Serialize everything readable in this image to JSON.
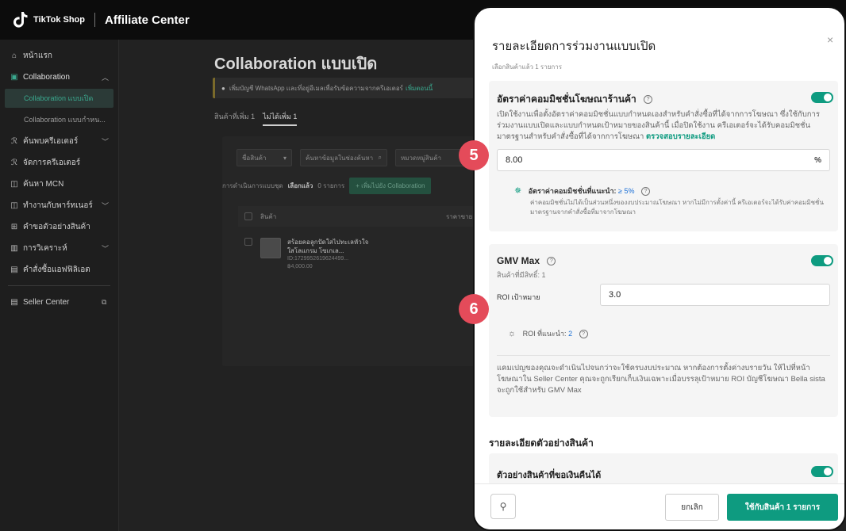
{
  "topbar": {
    "logo_text": "TikTok Shop",
    "title": "Affiliate Center"
  },
  "sidebar": {
    "items": [
      {
        "label": "หน้าแรก"
      },
      {
        "label": "Collaboration"
      },
      {
        "label": "Collaboration แบบเปิด"
      },
      {
        "label": "Collaboration แบบกำหน..."
      },
      {
        "label": "ค้นพบครีเอเตอร์"
      },
      {
        "label": "จัดการครีเอเตอร์"
      },
      {
        "label": "ค้นหา MCN"
      },
      {
        "label": "ทำงานกับพาร์ทเนอร์"
      },
      {
        "label": "คำขอตัวอย่างสินค้า"
      },
      {
        "label": "การวิเคราะห์"
      },
      {
        "label": "คำสั่งซื้อแอฟฟิลิเอต"
      },
      {
        "label": "Seller Center"
      }
    ]
  },
  "main": {
    "page_title": "Collaboration แบบเปิด",
    "banner_text": "เพิ่มบัญชี WhatsApp และที่อยู่อีเมลเพื่อรับข้อความจากครีเอเตอร์",
    "banner_link": "เพิ่มตอนนี้",
    "tabs": [
      "สินค้าที่เพิ่ม 1",
      "ไม่ได้เพิ่ม 1"
    ],
    "filter_field": "ชื่อสินค้า",
    "filter_search_placeholder": "ค้นหาข้อมูลในช่องค้นหา",
    "filter_category_placeholder": "หมวดหมู่สินค้า",
    "bulk_label": "การดำเนินการแบบชุด",
    "bulk_selected": "เลือกแล้ว",
    "bulk_count": "0 รายการ",
    "bulk_button": "+ เพิ่มไปยัง Collaboration",
    "col_product": "สินค้า",
    "col_right": "ราคาขาย",
    "product": {
      "name": "สร้อยคอลูกปัดใสไปทะเลหัวใจใสโลแกรม โซเกเล...",
      "id": "ID:1729952619624499...",
      "price": "฿4,000.00"
    }
  },
  "modal": {
    "title": "รายละเอียดการร่วมงานแบบเปิด",
    "subtitle": "เลือกสินค้าแล้ว 1 รายการ",
    "close": "×",
    "commission": {
      "title": "อัตราค่าคอมมิชชั่นโฆษณาร้านค้า",
      "desc": "เปิดใช้งานเพื่อตั้งอัตราค่าคอมมิชชั่นแบบกำหนดเองสำหรับคำสั่งซื้อที่ได้จากการโฆษณา ซึ่งใช้กับการร่วมงานแบบเปิดและแบบกำหนดเป้าหมายของสินค้านี้ เมื่อปิดใช้งาน ครีเอเตอร์จะได้รับคอมมิชชั่นมาตรฐานสำหรับคำสั่งซื้อที่ได้จากการโฆษณา",
      "link": "ตรวจสอบรายละเอียด",
      "value": "8.00",
      "suffix": "%",
      "rec_label": "อัตราค่าคอมมิชชั่นที่แนะนำ:",
      "rec_value": "≥ 5%",
      "rec_desc": "ค่าคอมมิชชั่นไม่ได้เป็นส่วนหนึ่งของงบประมาณโฆษณา หากไม่มีการตั้งค่านี้ ครีเอเตอร์จะได้รับค่าคอมมิชชั่นมาตรฐานจากคำสั่งซื้อที่มาจากโฆษณา"
    },
    "gmv": {
      "title": "GMV Max",
      "subtitle": "สินค้าที่มีสิทธิ์: 1",
      "roi_label": "ROI เป้าหมาย",
      "roi_value": "3.0",
      "rec_label": "ROI ที่แนะนำ:",
      "rec_value": "2",
      "desc": "แคมเปญของคุณจะดำเนินไปจนกว่าจะใช้ครบงบประมาณ หากต้องการตั้งค่างบรายวัน ให้ไปที่หน้าโฆษณาใน Seller Center คุณจะถูกเรียกเก็บเงินเฉพาะเมื่อบรรลุเป้าหมาย ROI บัญชีโฆษณา Bella sista จะถูกใช้สำหรับ GMV Max"
    },
    "sample_section_title": "รายละเอียดตัวอย่างสินค้า",
    "sample": {
      "title": "ตัวอย่างสินค้าที่ขอเงินคืนได้"
    },
    "footer": {
      "cancel": "ยกเลิก",
      "apply": "ใช้กับสินค้า 1 รายการ"
    }
  },
  "badges": {
    "step5": "5",
    "step6": "6"
  },
  "colors": {
    "accent": "#0e9b80",
    "badge": "#e44b5a"
  }
}
